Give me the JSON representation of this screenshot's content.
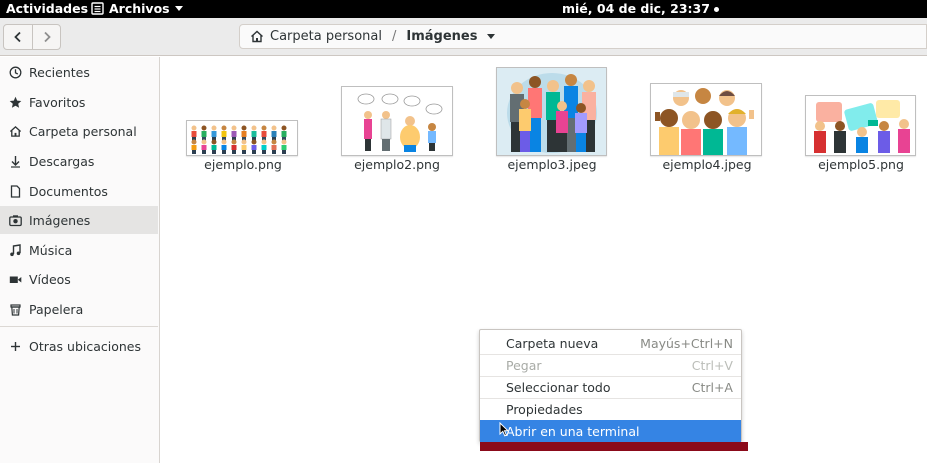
{
  "topbar": {
    "activities": "Actividades",
    "app_menu": "Archivos",
    "clock": "mié, 04 de dic, 23:37"
  },
  "header": {
    "back_icon": "chevron-left-icon",
    "forward_icon": "chevron-right-icon",
    "path": {
      "home_label": "Carpeta personal",
      "separator": "/",
      "current": "Imágenes"
    }
  },
  "sidebar": {
    "items": [
      {
        "label": "Recientes",
        "icon": "clock-icon"
      },
      {
        "label": "Favoritos",
        "icon": "star-icon"
      },
      {
        "label": "Carpeta personal",
        "icon": "home-icon"
      },
      {
        "label": "Descargas",
        "icon": "download-icon"
      },
      {
        "label": "Documentos",
        "icon": "document-icon"
      },
      {
        "label": "Imágenes",
        "icon": "camera-icon",
        "active": true
      },
      {
        "label": "Música",
        "icon": "music-icon"
      },
      {
        "label": "Vídeos",
        "icon": "video-icon"
      },
      {
        "label": "Papelera",
        "icon": "trash-icon"
      }
    ],
    "other_locations": "Otras ubicaciones"
  },
  "files": [
    {
      "name": "ejemplo.png"
    },
    {
      "name": "ejemplo2.png"
    },
    {
      "name": "ejemplo3.jpeg"
    },
    {
      "name": "ejemplo4.jpeg"
    },
    {
      "name": "ejemplo5.png"
    }
  ],
  "context_menu": {
    "items": [
      {
        "label": "Carpeta nueva",
        "accel": "Mayús+Ctrl+N",
        "enabled": true
      },
      {
        "label": "Pegar",
        "accel": "Ctrl+V",
        "enabled": false
      },
      {
        "label": "Seleccionar todo",
        "accel": "Ctrl+A",
        "enabled": true
      },
      {
        "label": "Propiedades",
        "accel": "",
        "enabled": true
      },
      {
        "label": "Abrir en una terminal",
        "accel": "",
        "enabled": true,
        "highlighted": true
      }
    ]
  },
  "colors": {
    "selection": "#3584e4",
    "topbar": "#000000",
    "headerbar": "#ebebeb",
    "sidebar_active": "#e5e4e3"
  }
}
